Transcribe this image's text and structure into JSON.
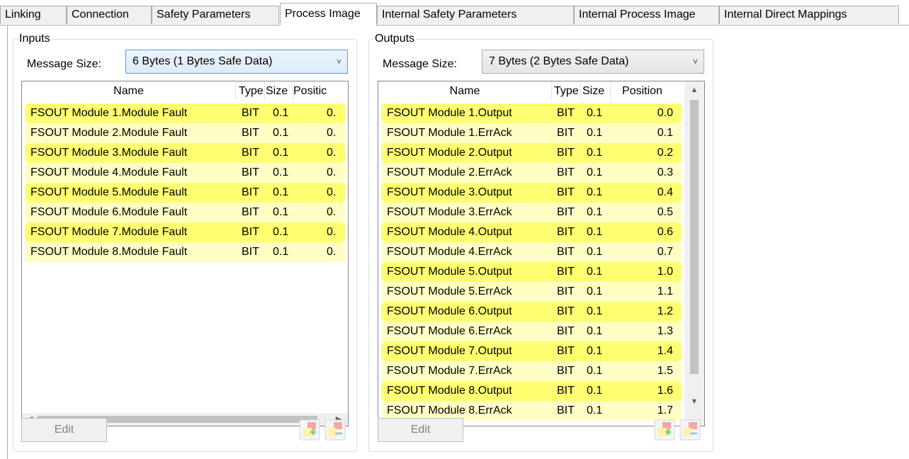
{
  "tabs": [
    {
      "label": "Linking"
    },
    {
      "label": "Connection"
    },
    {
      "label": "Safety Parameters"
    },
    {
      "label": "Process Image"
    },
    {
      "label": "Internal Safety Parameters"
    },
    {
      "label": "Internal Process Image"
    },
    {
      "label": "Internal Direct Mappings"
    }
  ],
  "inputs": {
    "legend": "Inputs",
    "message_size_label": "Message Size:",
    "message_size_value": "6 Bytes (1 Bytes Safe Data)",
    "columns": {
      "name": "Name",
      "type": "Type",
      "size": "Size",
      "position": "Positic"
    },
    "rows": [
      {
        "name": "FSOUT Module 1.Module Fault",
        "type": "BIT",
        "size": "0.1",
        "position": "0."
      },
      {
        "name": "FSOUT Module 2.Module Fault",
        "type": "BIT",
        "size": "0.1",
        "position": "0."
      },
      {
        "name": "FSOUT Module 3.Module Fault",
        "type": "BIT",
        "size": "0.1",
        "position": "0."
      },
      {
        "name": "FSOUT Module 4.Module Fault",
        "type": "BIT",
        "size": "0.1",
        "position": "0."
      },
      {
        "name": "FSOUT Module 5.Module Fault",
        "type": "BIT",
        "size": "0.1",
        "position": "0."
      },
      {
        "name": "FSOUT Module 6.Module Fault",
        "type": "BIT",
        "size": "0.1",
        "position": "0."
      },
      {
        "name": "FSOUT Module 7.Module Fault",
        "type": "BIT",
        "size": "0.1",
        "position": "0."
      },
      {
        "name": "FSOUT Module 8.Module Fault",
        "type": "BIT",
        "size": "0.1",
        "position": "0."
      }
    ],
    "edit_label": "Edit"
  },
  "outputs": {
    "legend": "Outputs",
    "message_size_label": "Message Size:",
    "message_size_value": "7 Bytes (2 Bytes Safe Data)",
    "columns": {
      "name": "Name",
      "type": "Type",
      "size": "Size",
      "position": "Position"
    },
    "rows": [
      {
        "name": "FSOUT Module 1.Output",
        "type": "BIT",
        "size": "0.1",
        "position": "0.0"
      },
      {
        "name": "FSOUT Module 1.ErrAck",
        "type": "BIT",
        "size": "0.1",
        "position": "0.1"
      },
      {
        "name": "FSOUT Module 2.Output",
        "type": "BIT",
        "size": "0.1",
        "position": "0.2"
      },
      {
        "name": "FSOUT Module 2.ErrAck",
        "type": "BIT",
        "size": "0.1",
        "position": "0.3"
      },
      {
        "name": "FSOUT Module 3.Output",
        "type": "BIT",
        "size": "0.1",
        "position": "0.4"
      },
      {
        "name": "FSOUT Module 3.ErrAck",
        "type": "BIT",
        "size": "0.1",
        "position": "0.5"
      },
      {
        "name": "FSOUT Module 4.Output",
        "type": "BIT",
        "size": "0.1",
        "position": "0.6"
      },
      {
        "name": "FSOUT Module 4.ErrAck",
        "type": "BIT",
        "size": "0.1",
        "position": "0.7"
      },
      {
        "name": "FSOUT Module 5.Output",
        "type": "BIT",
        "size": "0.1",
        "position": "1.0"
      },
      {
        "name": "FSOUT Module 5.ErrAck",
        "type": "BIT",
        "size": "0.1",
        "position": "1.1"
      },
      {
        "name": "FSOUT Module 6.Output",
        "type": "BIT",
        "size": "0.1",
        "position": "1.2"
      },
      {
        "name": "FSOUT Module 6.ErrAck",
        "type": "BIT",
        "size": "0.1",
        "position": "1.3"
      },
      {
        "name": "FSOUT Module 7.Output",
        "type": "BIT",
        "size": "0.1",
        "position": "1.4"
      },
      {
        "name": "FSOUT Module 7.ErrAck",
        "type": "BIT",
        "size": "0.1",
        "position": "1.5"
      },
      {
        "name": "FSOUT Module 8.Output",
        "type": "BIT",
        "size": "0.1",
        "position": "1.6"
      },
      {
        "name": "FSOUT Module 8.ErrAck",
        "type": "BIT",
        "size": "0.1",
        "position": "1.7"
      }
    ],
    "edit_label": "Edit"
  },
  "colors": {
    "row_highlight": "#ffff72",
    "row_light": "#ffffc5",
    "focus_border": "#569de5"
  }
}
